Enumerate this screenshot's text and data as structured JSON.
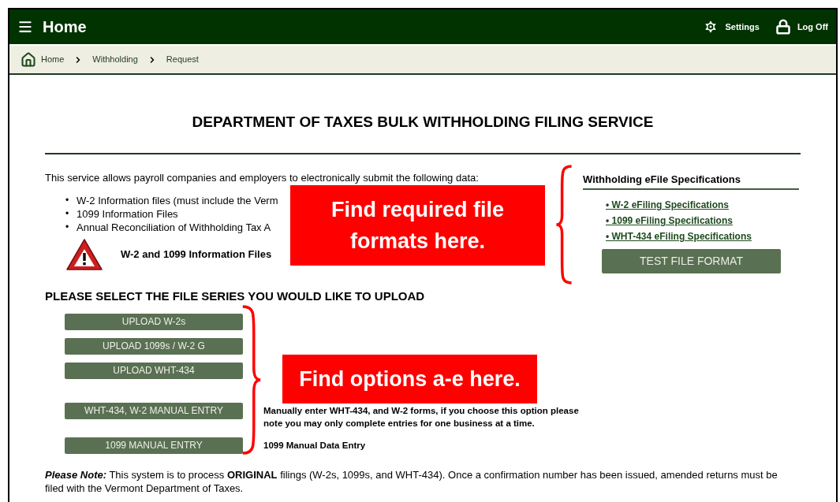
{
  "header": {
    "title": "Home",
    "actions": [
      {
        "kind": "settings",
        "label": "Settings"
      },
      {
        "kind": "logoff",
        "label": "Log Off"
      }
    ]
  },
  "breadcrumb": [
    {
      "kind": "home",
      "label": "Home"
    },
    {
      "kind": "plain",
      "label": "Withholding"
    },
    {
      "kind": "plain",
      "label": "Request"
    }
  ],
  "page_title": "DEPARTMENT OF TAXES BULK WITHHOLDING FILING SERVICE",
  "intro": "This service allows payroll companies and employers to electronically submit the following data:",
  "bullets": [
    {
      "marker": "•",
      "text": "W-2 Information files (must include the Verm"
    },
    {
      "marker": "•",
      "text": "1099 Information Files"
    },
    {
      "marker": "•",
      "text": "Annual Reconciliation of Withholding Tax A"
    }
  ],
  "warning": "W-2 and 1099 Information Files",
  "upload_heading": "PLEASE SELECT THE FILE SERIES YOU WOULD LIKE TO UPLOAD",
  "uploads": [
    {
      "kind": "upload",
      "label": "UPLOAD W-2s"
    },
    {
      "kind": "upload",
      "label": "UPLOAD 1099s / W-2 G"
    },
    {
      "kind": "upload",
      "label": "UPLOAD WHT-434"
    },
    {
      "kind": "manual",
      "label": "WHT-434, W-2 MANUAL ENTRY",
      "description": "Manually enter WHT-434, and W-2 forms, if you choose this option please note you may only complete entries for one business at a time."
    },
    {
      "kind": "manual",
      "label": "1099 MANUAL ENTRY",
      "description": "1099 Manual Data Entry"
    }
  ],
  "specs": {
    "heading": "Withholding eFile Specifications",
    "links": [
      "• W-2 eFiling Specifications",
      "• 1099 eFiling Specifications",
      "• WHT-434 eFiling Specifications"
    ],
    "button": "TEST FILE FORMAT"
  },
  "note": "**Please Note:** This system is to process **ORIGINAL** filings (W-2s, 1099s, and WHT-434). Once a confirmation number has been issued, amended returns must be filed with the Vermont Department of Taxes.",
  "callouts": [
    {
      "text": "Find required file formats here."
    },
    {
      "text": "Find options a-e here."
    }
  ]
}
